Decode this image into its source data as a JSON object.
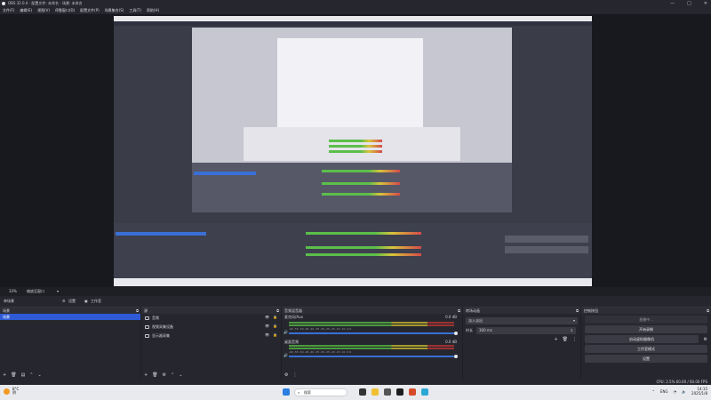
{
  "window": {
    "title": "OBS 32.0.4 - 配置文件: 未命名 - 场景: 未命名",
    "min": "—",
    "max": "□",
    "close": "✕"
  },
  "menu": [
    "文件(F)",
    "编辑(E)",
    "视图(V)",
    "停靠窗口(D)",
    "配置文件(P)",
    "场景集合(S)",
    "工具(T)",
    "帮助(H)"
  ],
  "preview_footer": {
    "zoom": "33%",
    "scale_label": "缩放至窗口"
  },
  "scene_toolbar": {
    "label": "单场景",
    "settings": "设置",
    "studio": "工作室"
  },
  "scenes": {
    "title": "场景",
    "items": [
      "场景"
    ]
  },
  "sources": {
    "title": "源",
    "items": [
      {
        "name": "音频"
      },
      {
        "name": "视频采集设备"
      },
      {
        "name": "显示器采集"
      }
    ]
  },
  "mixer": {
    "title": "音频混音器",
    "channels": [
      {
        "name": "麦克风/Aux",
        "db": "0.0 dB",
        "level": 0.55
      },
      {
        "name": "桌面音频",
        "db": "0.0 dB",
        "level": 0.78
      }
    ],
    "ticks": "-60 -55 -50 -45 -40 -35 -30 -25 -20 -15 -10 -5 0"
  },
  "transitions": {
    "title": "转场动画",
    "type": "淡入淡出",
    "duration_label": "时长",
    "duration_value": "300 ms"
  },
  "controls": {
    "title": "控制按钮",
    "buttons": [
      "直播中...",
      "开始录制",
      "启动虚拟摄像机",
      "工作室模式",
      "设置"
    ]
  },
  "status": {
    "cpu": "CPU: 2.5%",
    "fps": "60.00 / 60.00 FPS"
  },
  "taskbar": {
    "temp": "8°C",
    "weather": "阴",
    "search_placeholder": "搜索",
    "lang": "ENG",
    "time": "14:15",
    "date": "2025/1/8"
  },
  "colors": {
    "accent": "#2f5bd6",
    "meter_green": "#4c9a3e",
    "meter_yellow": "#a49a2e",
    "meter_red": "#9a3232"
  }
}
